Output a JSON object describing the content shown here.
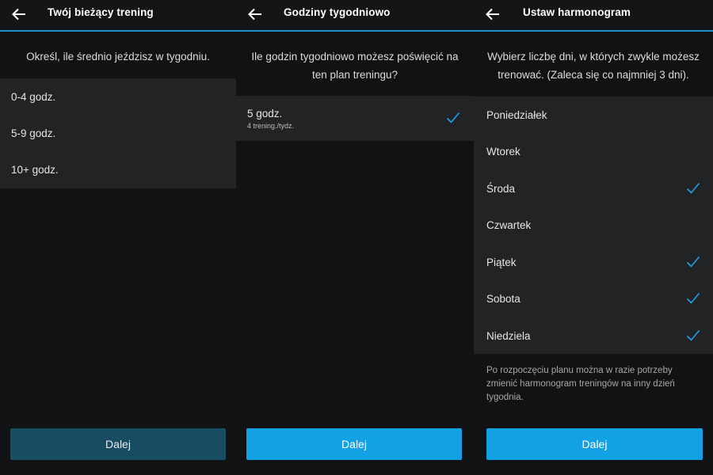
{
  "panel1": {
    "title": "Twój bieżący trening",
    "prompt": "Określ, ile średnio jeździsz w tygodniu.",
    "options": [
      "0-4 godz.",
      "5-9 godz.",
      "10+ godz."
    ],
    "button_label": "Dalej"
  },
  "panel2": {
    "title": "Godziny tygodniowo",
    "prompt_line1": "Ile godzin tygodniowo możesz poświęcić na",
    "prompt_line2": "ten plan treningu?",
    "option": {
      "label": "5 godz.",
      "sub": "4 trening./tydz.",
      "selected": true
    },
    "button_label": "Dalej"
  },
  "panel3": {
    "title": "Ustaw harmonogram",
    "prompt_line1": "Wybierz liczbę dni, w których zwykle możesz",
    "prompt_line2": "trenować. (Zaleca się co najmniej 3 dni).",
    "days": [
      {
        "label": "Poniedziałek",
        "selected": false
      },
      {
        "label": "Wtorek",
        "selected": false
      },
      {
        "label": "Środa",
        "selected": true
      },
      {
        "label": "Czwartek",
        "selected": false
      },
      {
        "label": "Piątek",
        "selected": true
      },
      {
        "label": "Sobota",
        "selected": true
      },
      {
        "label": "Niedziela",
        "selected": true
      }
    ],
    "note_line1": "Po rozpoczęciu planu można w razie potrzeby",
    "note_line2": "zmienić harmonogram treningów na inny dzień",
    "note_line3": "tygodnia.",
    "button_label": "Dalej"
  },
  "icons": {
    "back": "arrow-left-icon",
    "check": "checkmark-icon"
  },
  "colors": {
    "accent": "#12a2e3",
    "header_bar": "#1d8fcf",
    "disabled_button": "#184c63",
    "check": "#1da1e8"
  }
}
